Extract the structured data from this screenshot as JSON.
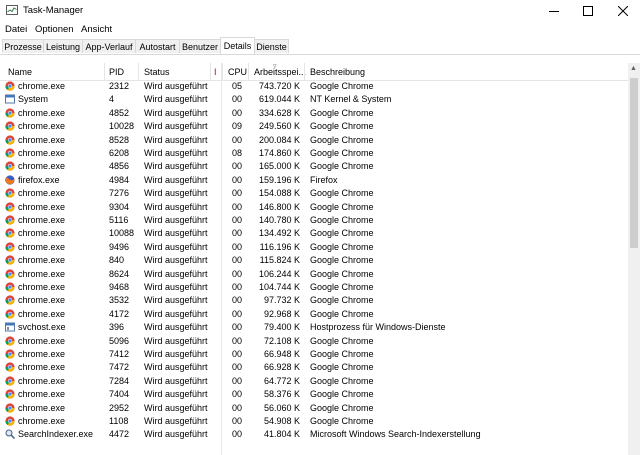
{
  "window": {
    "title": "Task-Manager"
  },
  "menu": [
    "Datei",
    "Optionen",
    "Ansicht"
  ],
  "tabs": [
    "Prozesse",
    "Leistung",
    "App-Verlauf",
    "Autostart",
    "Benutzer",
    "Details",
    "Dienste"
  ],
  "active_tab": "Details",
  "columns": [
    "Name",
    "PID",
    "Status",
    "I",
    "CPU",
    "Arbeitsspei...",
    "Beschreibung"
  ],
  "rows": [
    {
      "icon": "chrome-icon",
      "name": "chrome.exe",
      "pid": "2312",
      "status": "Wird ausgeführt",
      "cpu": "05",
      "mem": "743.720 K",
      "desc": "Google Chrome"
    },
    {
      "icon": "system-icon",
      "name": "System",
      "pid": "4",
      "status": "Wird ausgeführt",
      "cpu": "00",
      "mem": "619.044 K",
      "desc": "NT Kernel & System"
    },
    {
      "icon": "chrome-icon",
      "name": "chrome.exe",
      "pid": "4852",
      "status": "Wird ausgeführt",
      "cpu": "00",
      "mem": "334.628 K",
      "desc": "Google Chrome"
    },
    {
      "icon": "chrome-icon",
      "name": "chrome.exe",
      "pid": "10028",
      "status": "Wird ausgeführt",
      "cpu": "09",
      "mem": "249.560 K",
      "desc": "Google Chrome"
    },
    {
      "icon": "chrome-icon",
      "name": "chrome.exe",
      "pid": "8528",
      "status": "Wird ausgeführt",
      "cpu": "00",
      "mem": "200.084 K",
      "desc": "Google Chrome"
    },
    {
      "icon": "chrome-icon",
      "name": "chrome.exe",
      "pid": "6208",
      "status": "Wird ausgeführt",
      "cpu": "08",
      "mem": "174.860 K",
      "desc": "Google Chrome"
    },
    {
      "icon": "chrome-icon",
      "name": "chrome.exe",
      "pid": "4856",
      "status": "Wird ausgeführt",
      "cpu": "00",
      "mem": "165.000 K",
      "desc": "Google Chrome"
    },
    {
      "icon": "firefox-icon",
      "name": "firefox.exe",
      "pid": "4984",
      "status": "Wird ausgeführt",
      "cpu": "00",
      "mem": "159.196 K",
      "desc": "Firefox"
    },
    {
      "icon": "chrome-icon",
      "name": "chrome.exe",
      "pid": "7276",
      "status": "Wird ausgeführt",
      "cpu": "00",
      "mem": "154.088 K",
      "desc": "Google Chrome"
    },
    {
      "icon": "chrome-icon",
      "name": "chrome.exe",
      "pid": "9304",
      "status": "Wird ausgeführt",
      "cpu": "00",
      "mem": "146.800 K",
      "desc": "Google Chrome"
    },
    {
      "icon": "chrome-icon",
      "name": "chrome.exe",
      "pid": "5116",
      "status": "Wird ausgeführt",
      "cpu": "00",
      "mem": "140.780 K",
      "desc": "Google Chrome"
    },
    {
      "icon": "chrome-icon",
      "name": "chrome.exe",
      "pid": "10088",
      "status": "Wird ausgeführt",
      "cpu": "00",
      "mem": "134.492 K",
      "desc": "Google Chrome"
    },
    {
      "icon": "chrome-icon",
      "name": "chrome.exe",
      "pid": "9496",
      "status": "Wird ausgeführt",
      "cpu": "00",
      "mem": "116.196 K",
      "desc": "Google Chrome"
    },
    {
      "icon": "chrome-icon",
      "name": "chrome.exe",
      "pid": "840",
      "status": "Wird ausgeführt",
      "cpu": "00",
      "mem": "115.824 K",
      "desc": "Google Chrome"
    },
    {
      "icon": "chrome-icon",
      "name": "chrome.exe",
      "pid": "8624",
      "status": "Wird ausgeführt",
      "cpu": "00",
      "mem": "106.244 K",
      "desc": "Google Chrome"
    },
    {
      "icon": "chrome-icon",
      "name": "chrome.exe",
      "pid": "9468",
      "status": "Wird ausgeführt",
      "cpu": "00",
      "mem": "104.744 K",
      "desc": "Google Chrome"
    },
    {
      "icon": "chrome-icon",
      "name": "chrome.exe",
      "pid": "3532",
      "status": "Wird ausgeführt",
      "cpu": "00",
      "mem": "97.732 K",
      "desc": "Google Chrome"
    },
    {
      "icon": "chrome-icon",
      "name": "chrome.exe",
      "pid": "4172",
      "status": "Wird ausgeführt",
      "cpu": "00",
      "mem": "92.968 K",
      "desc": "Google Chrome"
    },
    {
      "icon": "svchost-icon",
      "name": "svchost.exe",
      "pid": "396",
      "status": "Wird ausgeführt",
      "cpu": "00",
      "mem": "79.400 K",
      "desc": "Hostprozess für Windows-Dienste"
    },
    {
      "icon": "chrome-icon",
      "name": "chrome.exe",
      "pid": "5096",
      "status": "Wird ausgeführt",
      "cpu": "00",
      "mem": "72.108 K",
      "desc": "Google Chrome"
    },
    {
      "icon": "chrome-icon",
      "name": "chrome.exe",
      "pid": "7412",
      "status": "Wird ausgeführt",
      "cpu": "00",
      "mem": "66.948 K",
      "desc": "Google Chrome"
    },
    {
      "icon": "chrome-icon",
      "name": "chrome.exe",
      "pid": "7472",
      "status": "Wird ausgeführt",
      "cpu": "00",
      "mem": "66.928 K",
      "desc": "Google Chrome"
    },
    {
      "icon": "chrome-icon",
      "name": "chrome.exe",
      "pid": "7284",
      "status": "Wird ausgeführt",
      "cpu": "00",
      "mem": "64.772 K",
      "desc": "Google Chrome"
    },
    {
      "icon": "chrome-icon",
      "name": "chrome.exe",
      "pid": "7404",
      "status": "Wird ausgeführt",
      "cpu": "00",
      "mem": "58.376 K",
      "desc": "Google Chrome"
    },
    {
      "icon": "chrome-icon",
      "name": "chrome.exe",
      "pid": "2952",
      "status": "Wird ausgeführt",
      "cpu": "00",
      "mem": "56.060 K",
      "desc": "Google Chrome"
    },
    {
      "icon": "chrome-icon",
      "name": "chrome.exe",
      "pid": "1108",
      "status": "Wird ausgeführt",
      "cpu": "00",
      "mem": "54.908 K",
      "desc": "Google Chrome"
    },
    {
      "icon": "search-indexer-icon",
      "name": "SearchIndexer.exe",
      "pid": "4472",
      "status": "Wird ausgeführt",
      "cpu": "00",
      "mem": "41.804 K",
      "desc": "Microsoft Windows Search-Indexerstellung"
    }
  ],
  "colors": {
    "selected_tab_border": "#d9d9d9",
    "column_marker": "#d40000"
  }
}
